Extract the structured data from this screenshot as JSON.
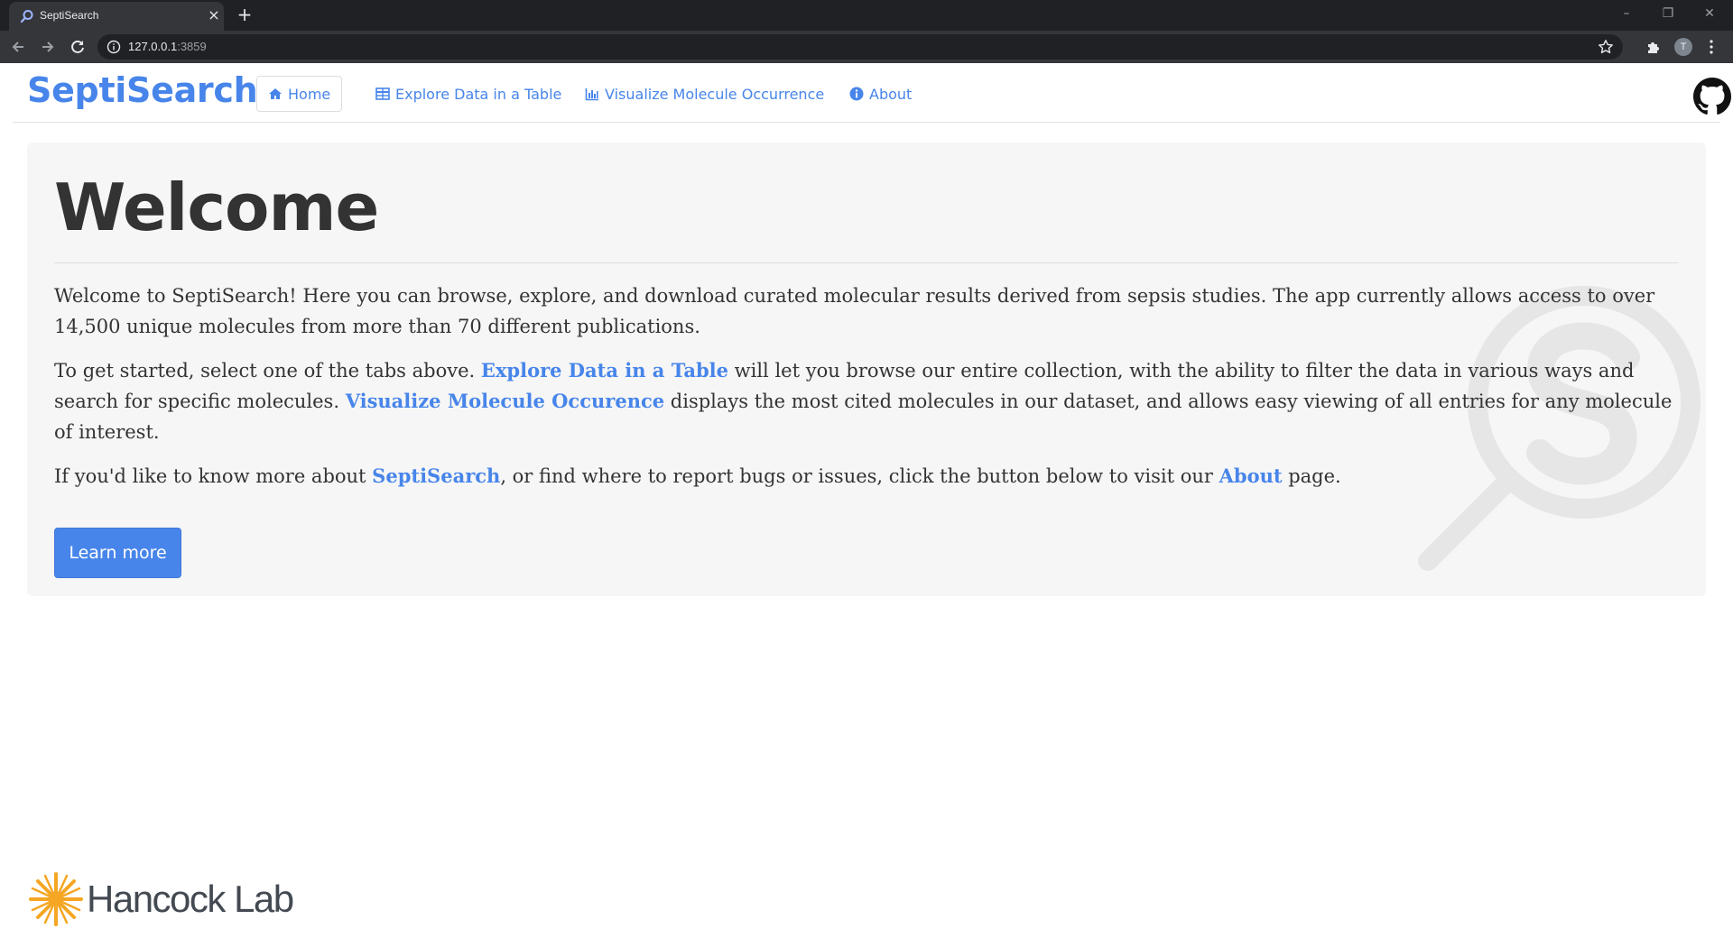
{
  "browser": {
    "tab_title": "SeptiSearch",
    "new_tab_symbol": "+",
    "url_host": "127.0.0.1",
    "url_port": ":3859",
    "profile_initial": "T"
  },
  "nav": {
    "brand": "SeptiSearch",
    "items": [
      {
        "label": "Home",
        "icon": "home-icon",
        "active": true
      },
      {
        "label": "Explore Data in a Table",
        "icon": "table-icon",
        "active": false
      },
      {
        "label": "Visualize Molecule Occurrence",
        "icon": "bar-chart-icon",
        "active": false
      },
      {
        "label": "About",
        "icon": "info-circle-icon",
        "active": false
      }
    ],
    "github_icon": "github-icon"
  },
  "welcome": {
    "title": "Welcome",
    "p1": "Welcome to SeptiSearch! Here you can browse, explore, and download curated molecular results derived from sepsis studies. The app currently allows access to over 14,500 unique molecules from more than 70 different publications.",
    "p2_a": "To get started, select one of the tabs above. ",
    "p2_link1": "Explore Data in a Table",
    "p2_b": " will let you browse our entire collection, with the ability to filter the data in various ways and search for specific molecules. ",
    "p2_link2": "Visualize Molecule Occurence",
    "p2_c": " displays the most cited molecules in our dataset, and allows easy viewing of all entries for any molecule of interest.",
    "p3_a": "If you'd like to know more about ",
    "p3_link1": "SeptiSearch",
    "p3_b": ", or find where to report bugs or issues, click the button below to visit our ",
    "p3_link2": "About",
    "p3_c": " page.",
    "button_label": "Learn more"
  },
  "footer": {
    "logo_name": "Hancock Lab"
  },
  "colors": {
    "accent": "#4785ea",
    "jumbotron_bg": "#f6f6f6",
    "text": "#333333",
    "footer_logo": "#f5a623"
  }
}
